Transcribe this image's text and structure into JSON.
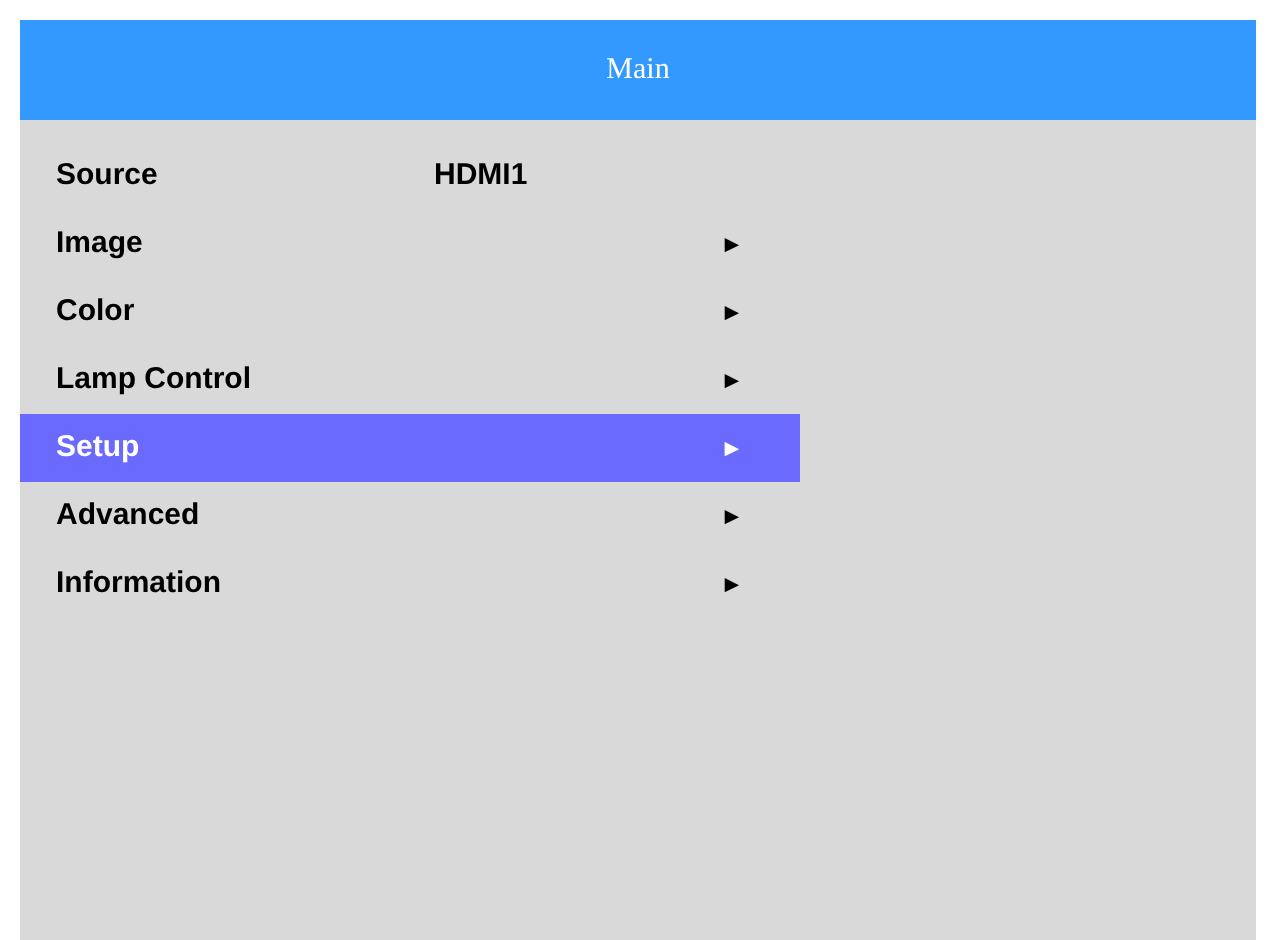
{
  "header": {
    "title": "Main"
  },
  "menu": [
    {
      "kind": "value",
      "label": "Source",
      "value": "HDMI1",
      "selected": false
    },
    {
      "kind": "submenu",
      "label": "Image",
      "arrow": "►",
      "selected": false
    },
    {
      "kind": "submenu",
      "label": "Color",
      "arrow": "►",
      "selected": false
    },
    {
      "kind": "submenu",
      "label": "Lamp Control",
      "arrow": "►",
      "selected": false
    },
    {
      "kind": "submenu",
      "label": "Setup",
      "arrow": "►",
      "selected": true
    },
    {
      "kind": "submenu",
      "label": "Advanced",
      "arrow": "►",
      "selected": false
    },
    {
      "kind": "submenu",
      "label": "Information",
      "arrow": "►",
      "selected": false
    }
  ]
}
